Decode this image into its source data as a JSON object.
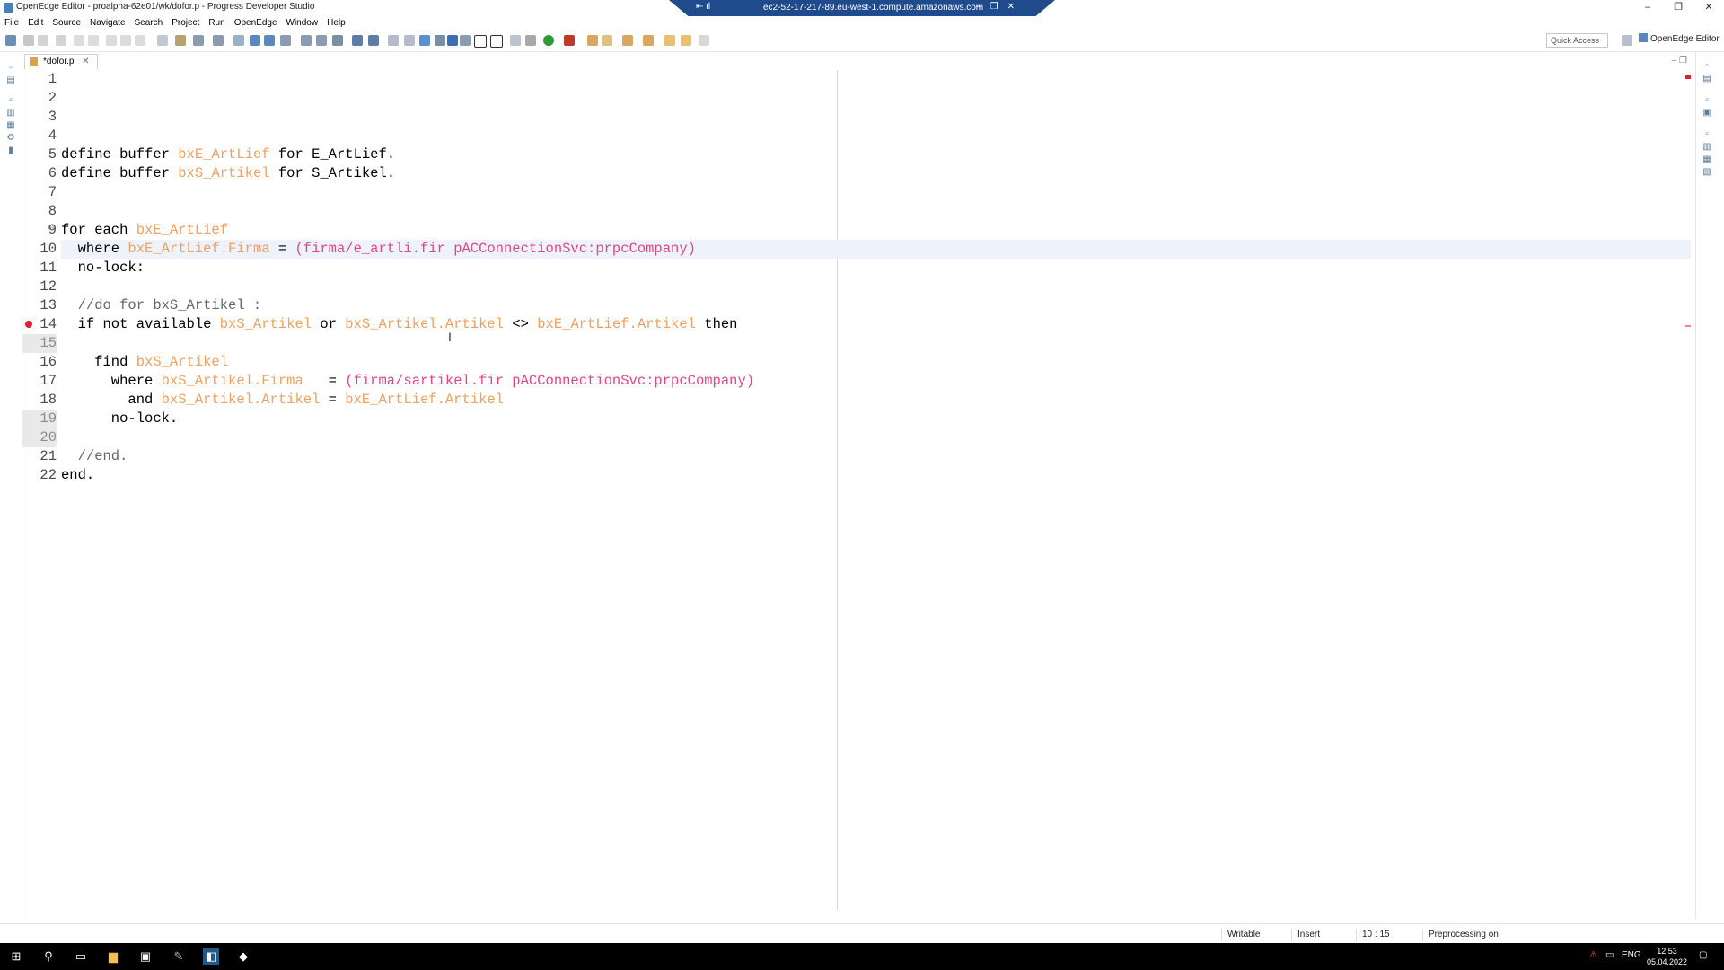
{
  "window": {
    "title": "OpenEdge Editor - proalpha-62e01/wk/dofor.p - Progress Developer Studio",
    "remote_host": "ec2-52-17-217-89.eu-west-1.compute.amazonaws.com",
    "min": "–",
    "max": "❐",
    "close": "✕"
  },
  "menu": [
    "File",
    "Edit",
    "Source",
    "Navigate",
    "Search",
    "Project",
    "Run",
    "OpenEdge",
    "Window",
    "Help"
  ],
  "toolbar": {
    "quick_access": "Quick Access",
    "perspective": "OpenEdge Editor"
  },
  "editor": {
    "tab_label": "*dofor.p",
    "tab_close": "✕",
    "line_numbers": [
      "1",
      "2",
      "3",
      "4",
      "5",
      "6",
      "7",
      "8",
      "9",
      "10",
      "11",
      "12",
      "13",
      "14",
      "15",
      "16",
      "17",
      "18",
      "19",
      "20",
      "21",
      "22"
    ],
    "lines": [
      [],
      [],
      [],
      [],
      [
        [
          "k",
          "define buffer "
        ],
        [
          "v",
          "bxE_ArtLief"
        ],
        [
          "k",
          " for E_ArtLief."
        ]
      ],
      [
        [
          "k",
          "define buffer "
        ],
        [
          "v",
          "bxS_Artikel"
        ],
        [
          "k",
          " for S_Artikel."
        ]
      ],
      [],
      [],
      [
        [
          "k",
          "for each "
        ],
        [
          "v",
          "bxE_ArtLief"
        ]
      ],
      [
        [
          "k",
          "  where "
        ],
        [
          "v",
          "bxE_ArtLief.Firma"
        ],
        [
          "k",
          " = "
        ],
        [
          "s",
          "(firma/e_artli.fir pACConnectionSvc:prpcCompany)"
        ]
      ],
      [
        [
          "k",
          "  no-lock:"
        ]
      ],
      [],
      [
        [
          "c",
          "  //do for bxS_Artikel :"
        ]
      ],
      [
        [
          "k",
          "  if not available "
        ],
        [
          "v",
          "bxS_Artikel"
        ],
        [
          "k",
          " or "
        ],
        [
          "v",
          "bxS_Artikel.Artikel"
        ],
        [
          "k",
          " <> "
        ],
        [
          "v",
          "bxE_ArtLief.Artikel"
        ],
        [
          "k",
          " then"
        ]
      ],
      [],
      [
        [
          "k",
          "    find "
        ],
        [
          "v",
          "bxS_Artikel"
        ]
      ],
      [
        [
          "k",
          "      where "
        ],
        [
          "v",
          "bxS_Artikel.Firma"
        ],
        [
          "k",
          "   = "
        ],
        [
          "s",
          "(firma/sartikel.fir pACConnectionSvc:prpcCompany)"
        ]
      ],
      [
        [
          "k",
          "        and "
        ],
        [
          "v",
          "bxS_Artikel.Artikel"
        ],
        [
          "k",
          " = "
        ],
        [
          "v",
          "bxE_ArtLief.Artikel"
        ]
      ],
      [
        [
          "k",
          "      no-lock."
        ]
      ],
      [],
      [
        [
          "c",
          "  //end."
        ]
      ],
      [
        [
          "k",
          "end."
        ]
      ]
    ]
  },
  "status": {
    "writable": "Writable",
    "insert": "Insert",
    "position": "10 : 15",
    "preprocessing": "Preprocessing on"
  },
  "taskbar": {
    "language": "ENG",
    "time": "12:53",
    "date": "05.04.2022"
  }
}
